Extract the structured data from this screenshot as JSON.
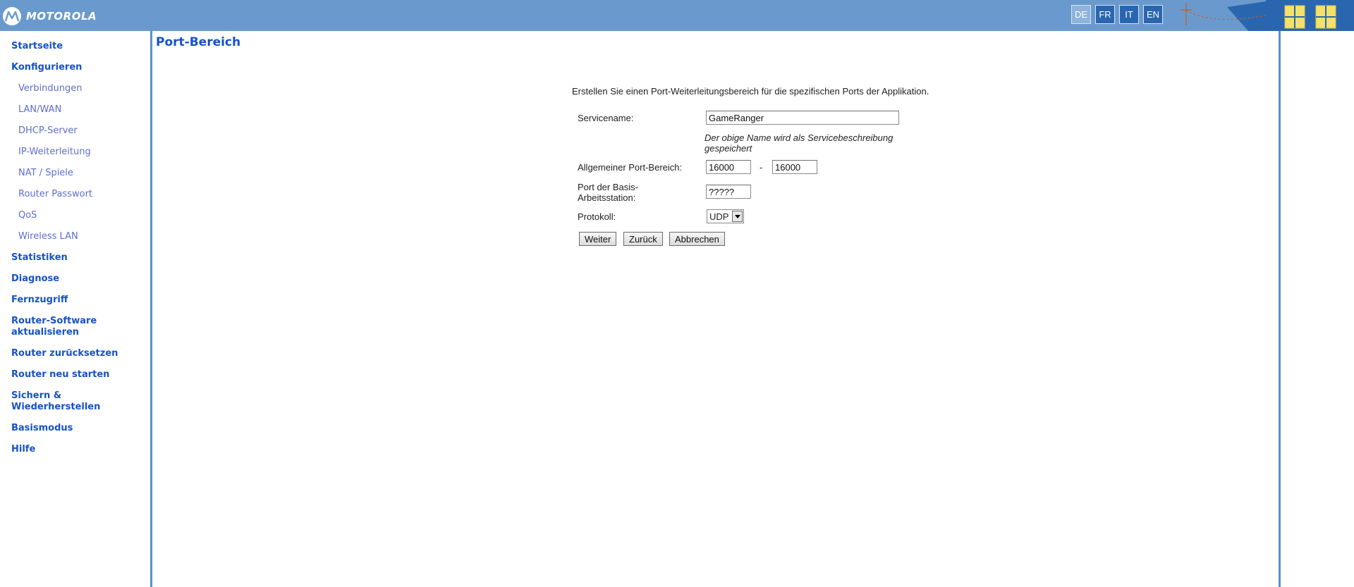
{
  "header": {
    "logo_text": "MOTOROLA",
    "languages": [
      {
        "code": "DE",
        "active": true
      },
      {
        "code": "FR",
        "active": false
      },
      {
        "code": "IT",
        "active": false
      },
      {
        "code": "EN",
        "active": false
      }
    ],
    "colors": {
      "bar": "#6a9acd",
      "lang_button": "#2a66b0",
      "accent_yellow": "#f5e06a"
    }
  },
  "sidebar": {
    "items": [
      {
        "label": "Startseite",
        "level": "main"
      },
      {
        "label": "Konfigurieren",
        "level": "main"
      },
      {
        "label": "Verbindungen",
        "level": "sub"
      },
      {
        "label": "LAN/WAN",
        "level": "sub"
      },
      {
        "label": "DHCP-Server",
        "level": "sub"
      },
      {
        "label": "IP-Weiterleitung",
        "level": "sub"
      },
      {
        "label": "NAT / Spiele",
        "level": "sub"
      },
      {
        "label": "Router Passwort",
        "level": "sub"
      },
      {
        "label": "QoS",
        "level": "sub"
      },
      {
        "label": "Wireless LAN",
        "level": "sub"
      },
      {
        "label": "Statistiken",
        "level": "main"
      },
      {
        "label": "Diagnose",
        "level": "main"
      },
      {
        "label": "Fernzugriff",
        "level": "main"
      },
      {
        "label": "Router-Software aktualisieren",
        "level": "main"
      },
      {
        "label": "Router zurücksetzen",
        "level": "main"
      },
      {
        "label": "Router neu starten",
        "level": "main"
      },
      {
        "label": "Sichern & Wiederherstellen",
        "level": "main"
      },
      {
        "label": "Basismodus",
        "level": "main"
      },
      {
        "label": "Hilfe",
        "level": "main"
      }
    ]
  },
  "page": {
    "title": "Port-Bereich",
    "intro": "Erstellen Sie einen Port-Weiterleitungsbereich für die spezifischen Ports der Applikation."
  },
  "form": {
    "service_name": {
      "label": "Servicename:",
      "value": "GameRanger"
    },
    "hint": "Der obige Name wird als Servicebeschreibung gespeichert",
    "port_range": {
      "label": "Allgemeiner Port-Bereich:",
      "start": "16000",
      "end": "16000",
      "separator": "-"
    },
    "base_port": {
      "label": "Port der Basis-Arbeitsstation:",
      "value": "?????"
    },
    "protocol": {
      "label": "Protokoll:",
      "value": "UDP"
    }
  },
  "buttons": {
    "next": "Weiter",
    "back": "Zurück",
    "cancel": "Abbrechen"
  }
}
